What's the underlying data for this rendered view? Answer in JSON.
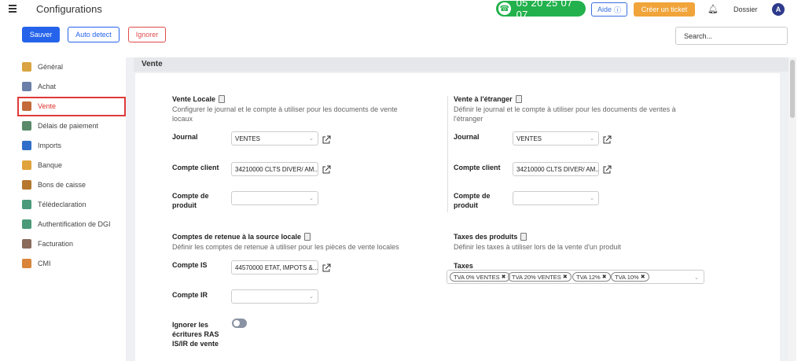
{
  "app": {
    "title": "Configurations"
  },
  "topbar": {
    "phone": "05 20 25 07 07",
    "help_label": "Aide",
    "ticket_label": "Créer un ticket",
    "dossier_label": "Dossier",
    "avatar_letter": "A"
  },
  "actions": {
    "save_label": "Sauver",
    "auto_detect_label": "Auto detect",
    "ignore_label": "Ignorer",
    "search_placeholder": "Search..."
  },
  "sidebar": {
    "active_index": 2,
    "items": [
      {
        "label": "Général",
        "icon": "gear-icon",
        "color": "#d9a441"
      },
      {
        "label": "Achat",
        "icon": "cart-icon",
        "color": "#6b7fa8"
      },
      {
        "label": "Vente",
        "icon": "chart-icon",
        "color": "#c46a3a"
      },
      {
        "label": "Délais de paiement",
        "icon": "calendar-icon",
        "color": "#5a8a6a"
      },
      {
        "label": "Imports",
        "icon": "folder-icon",
        "color": "#2f6fc9"
      },
      {
        "label": "Banque",
        "icon": "bank-icon",
        "color": "#e0a23a"
      },
      {
        "label": "Bons de caisse",
        "icon": "receipt-icon",
        "color": "#b5772e"
      },
      {
        "label": "Télédeclaration",
        "icon": "document-icon",
        "color": "#4a9a7a"
      },
      {
        "label": "Authentification de DGI",
        "icon": "key-icon",
        "color": "#4a9a7a"
      },
      {
        "label": "Facturation",
        "icon": "tag-icon",
        "color": "#8a6a5a"
      },
      {
        "label": "CMI",
        "icon": "card-icon",
        "color": "#d9843a"
      }
    ]
  },
  "main": {
    "header": "Vente",
    "vente_locale": {
      "title": "Vente Locale",
      "desc_line1": "Configurer le journal et le compte à utiliser pour les documents de vente",
      "desc_line2": "locaux",
      "journal_label": "Journal",
      "journal_value": "VENTES",
      "client_label": "Compte client",
      "client_value": "34210000 CLTS DIVER/ AM...",
      "produit_label_1": "Compte de",
      "produit_label_2": "produit",
      "produit_value": ""
    },
    "vente_etranger": {
      "title": "Vente à l'étranger",
      "desc_line1": "Définir le journal et le compte à utiliser pour les documents de ventes à",
      "desc_line2": "l'étranger",
      "journal_label": "Journal",
      "journal_value": "VENTES",
      "client_label": "Compte client",
      "client_value": "34210000 CLTS DIVER/ AM...",
      "produit_label_1": "Compte de",
      "produit_label_2": "produit",
      "produit_value": ""
    },
    "retenue": {
      "title": "Comptes de retenue à la source locale",
      "desc": "Définir les comptes de retenue à utiliser pour les pièces de vente locales",
      "is_label": "Compte IS",
      "is_value": "44570000 ETAT, IMPOTS &...",
      "ir_label": "Compte IR",
      "ir_value": "",
      "ignore_l1": "Ignorer les",
      "ignore_l2": "écritures RAS",
      "ignore_l3": "IS/IR de vente"
    },
    "taxes": {
      "title": "Taxes des produits",
      "desc": "Définir les taxes à utiliser lors de la vente d'un produit",
      "label": "Taxes",
      "items": [
        "TVA 0% VENTES",
        "TVA 20% VENTES",
        "TVA 12%",
        "TVA 10%"
      ]
    }
  }
}
